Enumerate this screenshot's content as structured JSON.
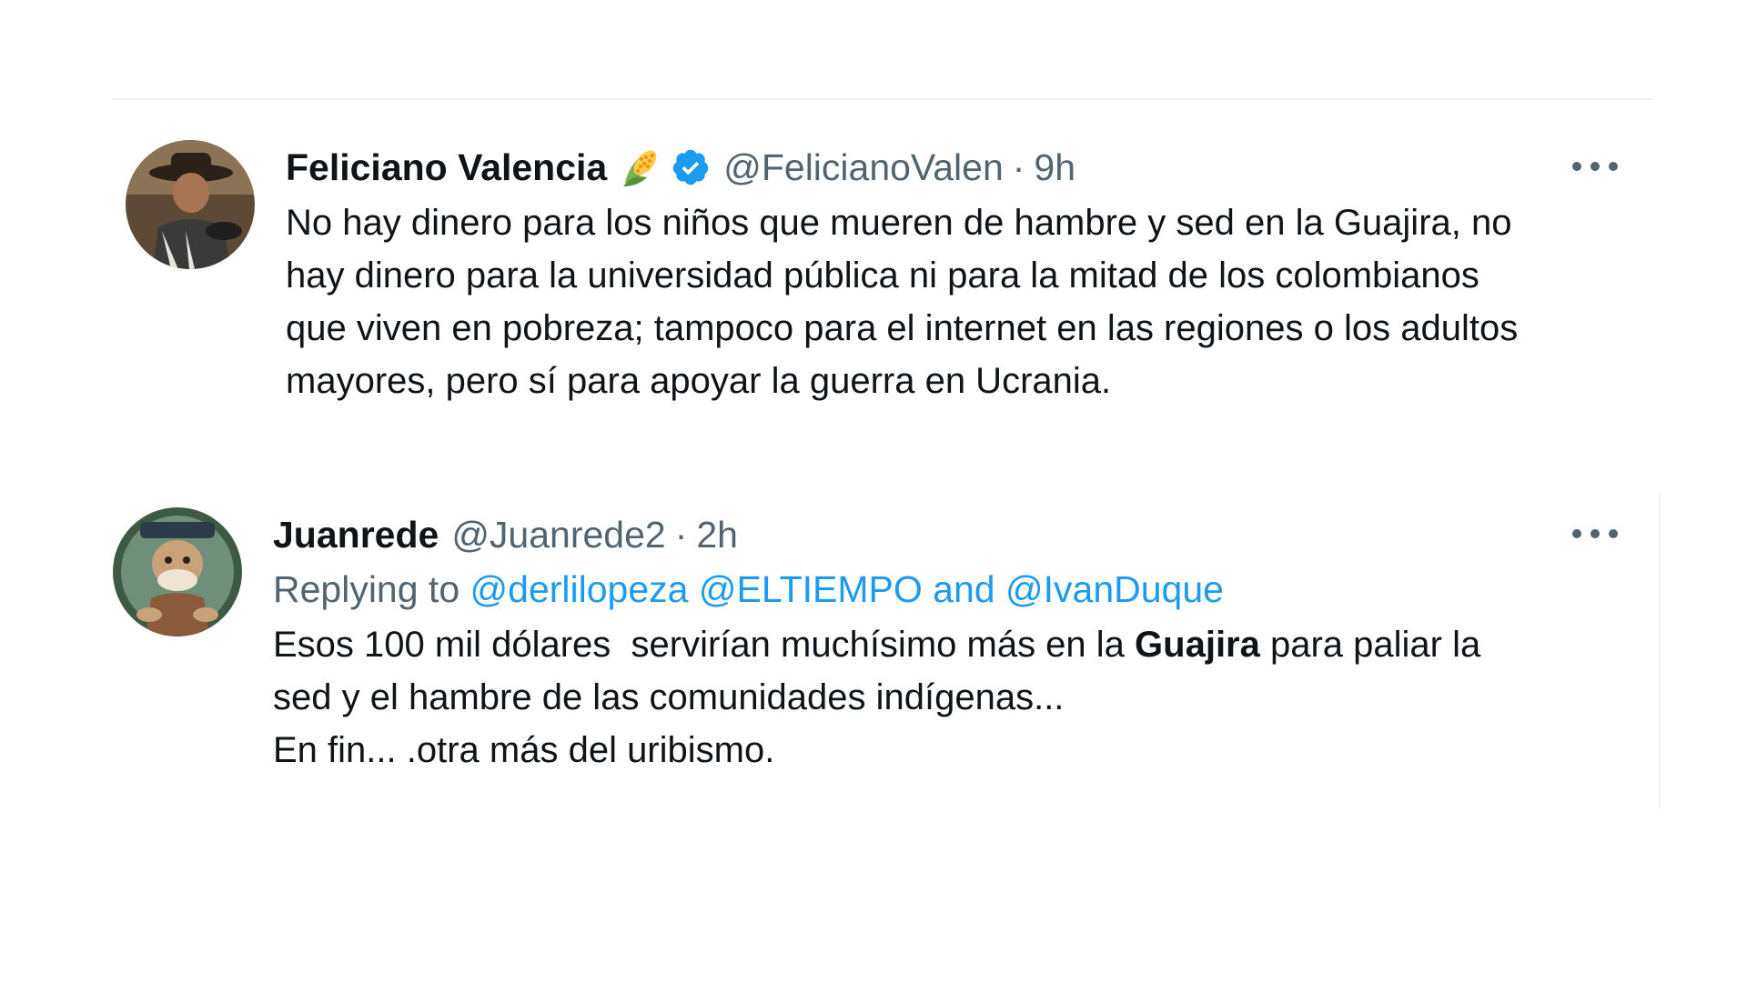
{
  "tweets": [
    {
      "name": "Feliciano Valencia",
      "handle": "@FelicianoValen",
      "separator": "·",
      "time": "9h",
      "badge_emoji": "corn-emoji",
      "verified": true,
      "text_lines": [
        "No hay dinero para los niños que mueren de hambre y sed en la Guajira, no",
        "hay dinero para la universidad pública ni para la mitad de los colombianos",
        "que viven en pobreza; tampoco para el internet en las regiones o los adultos",
        "mayores, pero sí para apoyar la guerra en Ucrania."
      ]
    },
    {
      "name": "Juanrede",
      "handle": "@Juanrede2",
      "separator": "·",
      "time": "2h",
      "replying_to_label": "Replying to",
      "mention_1": "@derlilopeza",
      "mention_2": "@ELTIEMPO",
      "mention_joiner": "and",
      "mention_3": "@IvanDuque",
      "line1_pre": "Esos 100 mil dólares  servirían muchísimo más en la ",
      "line1_bold": "Guajira",
      "line1_post": " para paliar la",
      "line2": "sed y el hambre de las comunidades indígenas...",
      "line3": "En fin... .otra más del uribismo."
    }
  ],
  "icons": {
    "more": "more-horizontal-icon",
    "verified": "verified-badge-icon"
  },
  "colors": {
    "text_primary": "#0f1419",
    "text_secondary": "#536471",
    "accent": "#1d9bf0",
    "divider": "#eff3f4"
  }
}
